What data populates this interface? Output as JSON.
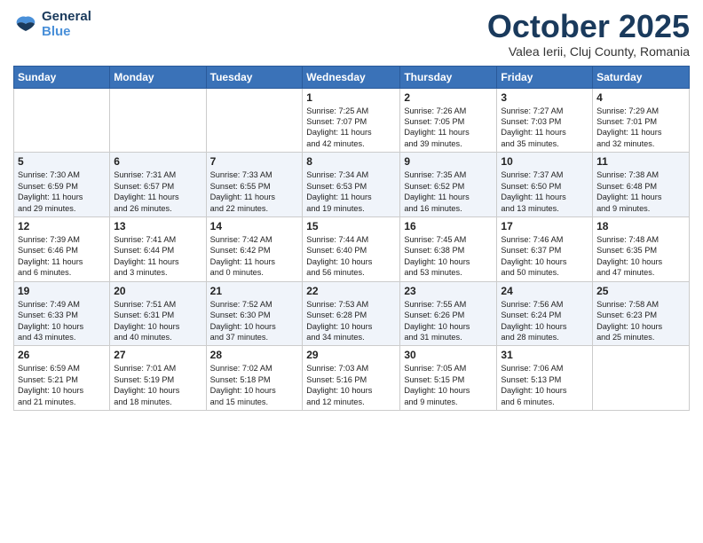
{
  "header": {
    "logo_line1": "General",
    "logo_line2": "Blue",
    "month": "October 2025",
    "location": "Valea Ierii, Cluj County, Romania"
  },
  "days_of_week": [
    "Sunday",
    "Monday",
    "Tuesday",
    "Wednesday",
    "Thursday",
    "Friday",
    "Saturday"
  ],
  "weeks": [
    [
      {
        "day": "",
        "info": ""
      },
      {
        "day": "",
        "info": ""
      },
      {
        "day": "",
        "info": ""
      },
      {
        "day": "1",
        "info": "Sunrise: 7:25 AM\nSunset: 7:07 PM\nDaylight: 11 hours\nand 42 minutes."
      },
      {
        "day": "2",
        "info": "Sunrise: 7:26 AM\nSunset: 7:05 PM\nDaylight: 11 hours\nand 39 minutes."
      },
      {
        "day": "3",
        "info": "Sunrise: 7:27 AM\nSunset: 7:03 PM\nDaylight: 11 hours\nand 35 minutes."
      },
      {
        "day": "4",
        "info": "Sunrise: 7:29 AM\nSunset: 7:01 PM\nDaylight: 11 hours\nand 32 minutes."
      }
    ],
    [
      {
        "day": "5",
        "info": "Sunrise: 7:30 AM\nSunset: 6:59 PM\nDaylight: 11 hours\nand 29 minutes."
      },
      {
        "day": "6",
        "info": "Sunrise: 7:31 AM\nSunset: 6:57 PM\nDaylight: 11 hours\nand 26 minutes."
      },
      {
        "day": "7",
        "info": "Sunrise: 7:33 AM\nSunset: 6:55 PM\nDaylight: 11 hours\nand 22 minutes."
      },
      {
        "day": "8",
        "info": "Sunrise: 7:34 AM\nSunset: 6:53 PM\nDaylight: 11 hours\nand 19 minutes."
      },
      {
        "day": "9",
        "info": "Sunrise: 7:35 AM\nSunset: 6:52 PM\nDaylight: 11 hours\nand 16 minutes."
      },
      {
        "day": "10",
        "info": "Sunrise: 7:37 AM\nSunset: 6:50 PM\nDaylight: 11 hours\nand 13 minutes."
      },
      {
        "day": "11",
        "info": "Sunrise: 7:38 AM\nSunset: 6:48 PM\nDaylight: 11 hours\nand 9 minutes."
      }
    ],
    [
      {
        "day": "12",
        "info": "Sunrise: 7:39 AM\nSunset: 6:46 PM\nDaylight: 11 hours\nand 6 minutes."
      },
      {
        "day": "13",
        "info": "Sunrise: 7:41 AM\nSunset: 6:44 PM\nDaylight: 11 hours\nand 3 minutes."
      },
      {
        "day": "14",
        "info": "Sunrise: 7:42 AM\nSunset: 6:42 PM\nDaylight: 11 hours\nand 0 minutes."
      },
      {
        "day": "15",
        "info": "Sunrise: 7:44 AM\nSunset: 6:40 PM\nDaylight: 10 hours\nand 56 minutes."
      },
      {
        "day": "16",
        "info": "Sunrise: 7:45 AM\nSunset: 6:38 PM\nDaylight: 10 hours\nand 53 minutes."
      },
      {
        "day": "17",
        "info": "Sunrise: 7:46 AM\nSunset: 6:37 PM\nDaylight: 10 hours\nand 50 minutes."
      },
      {
        "day": "18",
        "info": "Sunrise: 7:48 AM\nSunset: 6:35 PM\nDaylight: 10 hours\nand 47 minutes."
      }
    ],
    [
      {
        "day": "19",
        "info": "Sunrise: 7:49 AM\nSunset: 6:33 PM\nDaylight: 10 hours\nand 43 minutes."
      },
      {
        "day": "20",
        "info": "Sunrise: 7:51 AM\nSunset: 6:31 PM\nDaylight: 10 hours\nand 40 minutes."
      },
      {
        "day": "21",
        "info": "Sunrise: 7:52 AM\nSunset: 6:30 PM\nDaylight: 10 hours\nand 37 minutes."
      },
      {
        "day": "22",
        "info": "Sunrise: 7:53 AM\nSunset: 6:28 PM\nDaylight: 10 hours\nand 34 minutes."
      },
      {
        "day": "23",
        "info": "Sunrise: 7:55 AM\nSunset: 6:26 PM\nDaylight: 10 hours\nand 31 minutes."
      },
      {
        "day": "24",
        "info": "Sunrise: 7:56 AM\nSunset: 6:24 PM\nDaylight: 10 hours\nand 28 minutes."
      },
      {
        "day": "25",
        "info": "Sunrise: 7:58 AM\nSunset: 6:23 PM\nDaylight: 10 hours\nand 25 minutes."
      }
    ],
    [
      {
        "day": "26",
        "info": "Sunrise: 6:59 AM\nSunset: 5:21 PM\nDaylight: 10 hours\nand 21 minutes."
      },
      {
        "day": "27",
        "info": "Sunrise: 7:01 AM\nSunset: 5:19 PM\nDaylight: 10 hours\nand 18 minutes."
      },
      {
        "day": "28",
        "info": "Sunrise: 7:02 AM\nSunset: 5:18 PM\nDaylight: 10 hours\nand 15 minutes."
      },
      {
        "day": "29",
        "info": "Sunrise: 7:03 AM\nSunset: 5:16 PM\nDaylight: 10 hours\nand 12 minutes."
      },
      {
        "day": "30",
        "info": "Sunrise: 7:05 AM\nSunset: 5:15 PM\nDaylight: 10 hours\nand 9 minutes."
      },
      {
        "day": "31",
        "info": "Sunrise: 7:06 AM\nSunset: 5:13 PM\nDaylight: 10 hours\nand 6 minutes."
      },
      {
        "day": "",
        "info": ""
      }
    ]
  ]
}
